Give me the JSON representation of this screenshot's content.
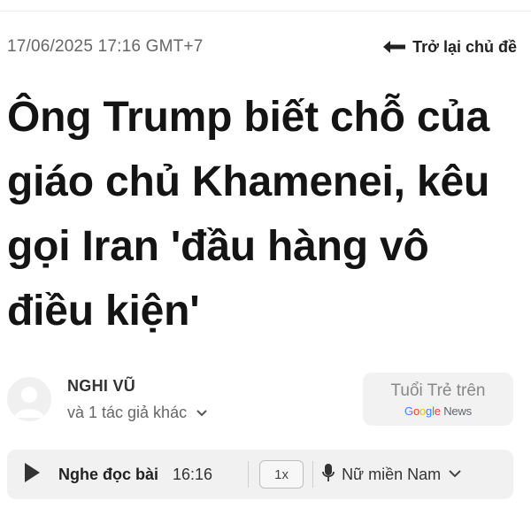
{
  "meta": {
    "timestamp": "17/06/2025 17:16 GMT+7",
    "back_label": "Trở lại chủ đề"
  },
  "article": {
    "headline": "Ông Trump biết chỗ của giáo chủ Khamenei, kêu gọi Iran 'đầu hàng vô điều kiện'"
  },
  "author": {
    "name": "NGHI VŨ",
    "more": "và 1 tác giả khác"
  },
  "follow": {
    "label": "Tuổi Trẻ trên",
    "logo_google": [
      "G",
      "o",
      "o",
      "g",
      "l",
      "e"
    ],
    "logo_news": "News"
  },
  "audio": {
    "label": "Nghe đọc bài",
    "duration": "16:16",
    "speed": "1x",
    "voice": "Nữ miền Nam"
  },
  "colors": {
    "google": [
      "#4285F4",
      "#EA4335",
      "#FBBC05",
      "#4285F4",
      "#34A853",
      "#EA4335"
    ],
    "news_text": "#5f6368"
  },
  "icons": {
    "back": "arrow-left-icon",
    "avatar": "user-avatar-icon",
    "expand": "chevron-down-icon",
    "play": "play-icon",
    "mic": "microphone-icon",
    "voice_menu": "chevron-down-icon"
  }
}
